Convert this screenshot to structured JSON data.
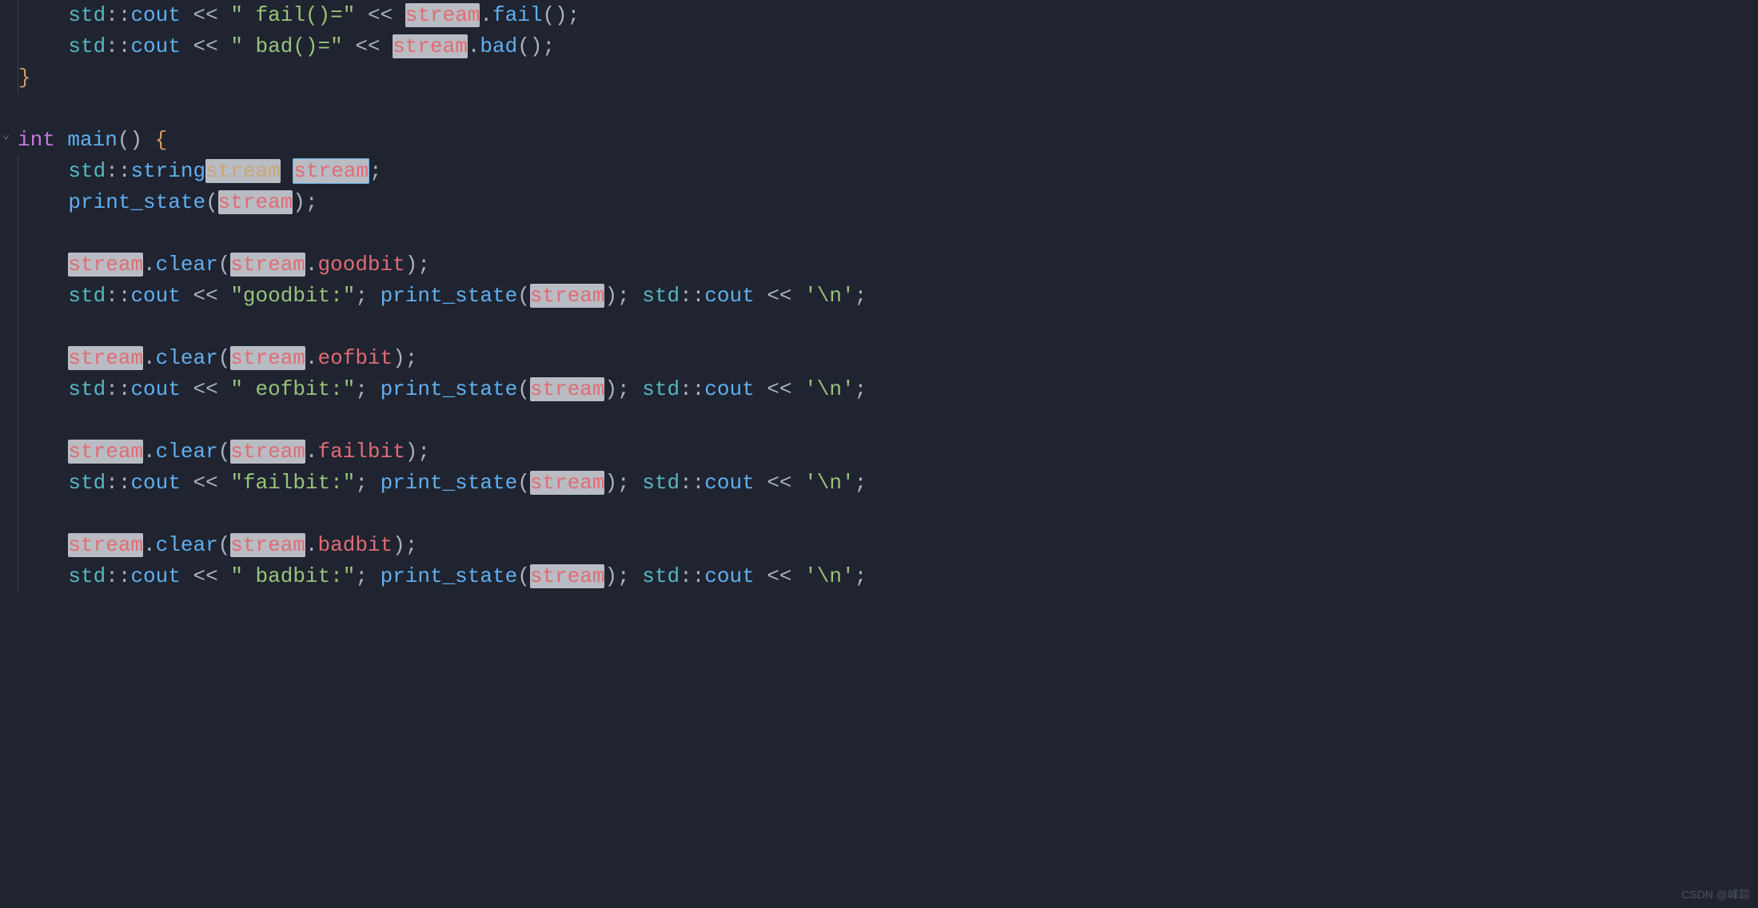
{
  "code": {
    "lines": [
      {
        "indent": "    ",
        "tokens": [
          [
            "std",
            "t-namespace"
          ],
          [
            "::",
            "t-plain"
          ],
          [
            "cout",
            "t-func"
          ],
          [
            " ",
            "t-plain"
          ],
          [
            "<<",
            "t-op"
          ],
          [
            " ",
            "t-plain"
          ],
          [
            "\" fail()=\"",
            "t-string"
          ],
          [
            " ",
            "t-plain"
          ],
          [
            "<<",
            "t-op"
          ],
          [
            " ",
            "t-plain"
          ],
          [
            "stream",
            "hl"
          ],
          [
            ".",
            "t-punc"
          ],
          [
            "fail",
            "t-func"
          ],
          [
            "();",
            "t-punc"
          ]
        ]
      },
      {
        "indent": "    ",
        "tokens": [
          [
            "std",
            "t-namespace"
          ],
          [
            "::",
            "t-plain"
          ],
          [
            "cout",
            "t-func"
          ],
          [
            " ",
            "t-plain"
          ],
          [
            "<<",
            "t-op"
          ],
          [
            " ",
            "t-plain"
          ],
          [
            "\" bad()=\"",
            "t-string"
          ],
          [
            " ",
            "t-plain"
          ],
          [
            "<<",
            "t-op"
          ],
          [
            " ",
            "t-plain"
          ],
          [
            "stream",
            "hl"
          ],
          [
            ".",
            "t-punc"
          ],
          [
            "bad",
            "t-func"
          ],
          [
            "();",
            "t-punc"
          ]
        ]
      },
      {
        "indent": "",
        "tokens": [
          [
            "}",
            "t-brace"
          ]
        ]
      },
      {
        "indent": "",
        "tokens": []
      },
      {
        "fold": "v",
        "indent": "",
        "tokens": [
          [
            "int",
            "t-type"
          ],
          [
            " ",
            "t-plain"
          ],
          [
            "main",
            "t-func"
          ],
          [
            "()",
            "t-punc"
          ],
          [
            " ",
            "t-plain"
          ],
          [
            "{",
            "t-brace"
          ]
        ]
      },
      {
        "indent": "    ",
        "tokens": [
          [
            "std",
            "t-namespace"
          ],
          [
            "::",
            "t-plain"
          ],
          [
            "string",
            "t-func"
          ],
          [
            "stream",
            "hl-dim"
          ],
          [
            " ",
            "t-plain"
          ],
          [
            "stream",
            "hl-box"
          ],
          [
            ";",
            "t-punc"
          ]
        ]
      },
      {
        "indent": "    ",
        "tokens": [
          [
            "print_state",
            "t-func"
          ],
          [
            "(",
            "t-punc"
          ],
          [
            "stream",
            "hl"
          ],
          [
            ")",
            "t-punc"
          ],
          [
            ";",
            "t-punc"
          ]
        ]
      },
      {
        "indent": "",
        "tokens": []
      },
      {
        "indent": "    ",
        "tokens": [
          [
            "stream",
            "hl"
          ],
          [
            ".",
            "t-punc"
          ],
          [
            "clear",
            "t-func"
          ],
          [
            "(",
            "t-punc"
          ],
          [
            "stream",
            "hl"
          ],
          [
            ".",
            "t-punc"
          ],
          [
            "goodbit",
            "t-prop"
          ],
          [
            ")",
            "t-punc"
          ],
          [
            ";",
            "t-punc"
          ]
        ]
      },
      {
        "indent": "    ",
        "tokens": [
          [
            "std",
            "t-namespace"
          ],
          [
            "::",
            "t-plain"
          ],
          [
            "cout",
            "t-func"
          ],
          [
            " ",
            "t-plain"
          ],
          [
            "<<",
            "t-op"
          ],
          [
            " ",
            "t-plain"
          ],
          [
            "\"goodbit:\"",
            "t-string"
          ],
          [
            ";",
            "t-punc"
          ],
          [
            " ",
            "t-plain"
          ],
          [
            "print_state",
            "t-func"
          ],
          [
            "(",
            "t-punc"
          ],
          [
            "stream",
            "hl"
          ],
          [
            ")",
            "t-punc"
          ],
          [
            ";",
            "t-punc"
          ],
          [
            " ",
            "t-plain"
          ],
          [
            "std",
            "t-namespace"
          ],
          [
            "::",
            "t-plain"
          ],
          [
            "cout",
            "t-func"
          ],
          [
            " ",
            "t-plain"
          ],
          [
            "<<",
            "t-op"
          ],
          [
            " ",
            "t-plain"
          ],
          [
            "'\\n'",
            "t-char"
          ],
          [
            ";",
            "t-punc"
          ]
        ]
      },
      {
        "indent": "",
        "tokens": []
      },
      {
        "indent": "    ",
        "tokens": [
          [
            "stream",
            "hl"
          ],
          [
            ".",
            "t-punc"
          ],
          [
            "clear",
            "t-func"
          ],
          [
            "(",
            "t-punc"
          ],
          [
            "stream",
            "hl"
          ],
          [
            ".",
            "t-punc"
          ],
          [
            "eofbit",
            "t-prop"
          ],
          [
            ")",
            "t-punc"
          ],
          [
            ";",
            "t-punc"
          ]
        ]
      },
      {
        "indent": "    ",
        "tokens": [
          [
            "std",
            "t-namespace"
          ],
          [
            "::",
            "t-plain"
          ],
          [
            "cout",
            "t-func"
          ],
          [
            " ",
            "t-plain"
          ],
          [
            "<<",
            "t-op"
          ],
          [
            " ",
            "t-plain"
          ],
          [
            "\" eofbit:\"",
            "t-string"
          ],
          [
            ";",
            "t-punc"
          ],
          [
            " ",
            "t-plain"
          ],
          [
            "print_state",
            "t-func"
          ],
          [
            "(",
            "t-punc"
          ],
          [
            "stream",
            "hl"
          ],
          [
            ")",
            "t-punc"
          ],
          [
            ";",
            "t-punc"
          ],
          [
            " ",
            "t-plain"
          ],
          [
            "std",
            "t-namespace"
          ],
          [
            "::",
            "t-plain"
          ],
          [
            "cout",
            "t-func"
          ],
          [
            " ",
            "t-plain"
          ],
          [
            "<<",
            "t-op"
          ],
          [
            " ",
            "t-plain"
          ],
          [
            "'\\n'",
            "t-char"
          ],
          [
            ";",
            "t-punc"
          ]
        ]
      },
      {
        "indent": "",
        "tokens": []
      },
      {
        "indent": "    ",
        "tokens": [
          [
            "stream",
            "hl"
          ],
          [
            ".",
            "t-punc"
          ],
          [
            "clear",
            "t-func"
          ],
          [
            "(",
            "t-punc"
          ],
          [
            "stream",
            "hl"
          ],
          [
            ".",
            "t-punc"
          ],
          [
            "failbit",
            "t-prop"
          ],
          [
            ")",
            "t-punc"
          ],
          [
            ";",
            "t-punc"
          ]
        ]
      },
      {
        "indent": "    ",
        "tokens": [
          [
            "std",
            "t-namespace"
          ],
          [
            "::",
            "t-plain"
          ],
          [
            "cout",
            "t-func"
          ],
          [
            " ",
            "t-plain"
          ],
          [
            "<<",
            "t-op"
          ],
          [
            " ",
            "t-plain"
          ],
          [
            "\"failbit:\"",
            "t-string"
          ],
          [
            ";",
            "t-punc"
          ],
          [
            " ",
            "t-plain"
          ],
          [
            "print_state",
            "t-func"
          ],
          [
            "(",
            "t-punc"
          ],
          [
            "stream",
            "hl"
          ],
          [
            ")",
            "t-punc"
          ],
          [
            ";",
            "t-punc"
          ],
          [
            " ",
            "t-plain"
          ],
          [
            "std",
            "t-namespace"
          ],
          [
            "::",
            "t-plain"
          ],
          [
            "cout",
            "t-func"
          ],
          [
            " ",
            "t-plain"
          ],
          [
            "<<",
            "t-op"
          ],
          [
            " ",
            "t-plain"
          ],
          [
            "'\\n'",
            "t-char"
          ],
          [
            ";",
            "t-punc"
          ]
        ]
      },
      {
        "indent": "",
        "tokens": []
      },
      {
        "indent": "    ",
        "tokens": [
          [
            "stream",
            "hl"
          ],
          [
            ".",
            "t-punc"
          ],
          [
            "clear",
            "t-func"
          ],
          [
            "(",
            "t-punc"
          ],
          [
            "stream",
            "hl"
          ],
          [
            ".",
            "t-punc"
          ],
          [
            "badbit",
            "t-prop"
          ],
          [
            ")",
            "t-punc"
          ],
          [
            ";",
            "t-punc"
          ]
        ]
      },
      {
        "indent": "    ",
        "tokens": [
          [
            "std",
            "t-namespace"
          ],
          [
            "::",
            "t-plain"
          ],
          [
            "cout",
            "t-func"
          ],
          [
            " ",
            "t-plain"
          ],
          [
            "<<",
            "t-op"
          ],
          [
            " ",
            "t-plain"
          ],
          [
            "\" badbit:\"",
            "t-string"
          ],
          [
            ";",
            "t-punc"
          ],
          [
            " ",
            "t-plain"
          ],
          [
            "print_state",
            "t-func"
          ],
          [
            "(",
            "t-punc"
          ],
          [
            "stream",
            "hl"
          ],
          [
            ")",
            "t-punc"
          ],
          [
            ";",
            "t-punc"
          ],
          [
            " ",
            "t-plain"
          ],
          [
            "std",
            "t-namespace"
          ],
          [
            "::",
            "t-plain"
          ],
          [
            "cout",
            "t-func"
          ],
          [
            " ",
            "t-plain"
          ],
          [
            "<<",
            "t-op"
          ],
          [
            " ",
            "t-plain"
          ],
          [
            "'\\n'",
            "t-char"
          ],
          [
            ";",
            "t-punc"
          ]
        ]
      }
    ]
  },
  "watermark": "CSDN @峰踪"
}
